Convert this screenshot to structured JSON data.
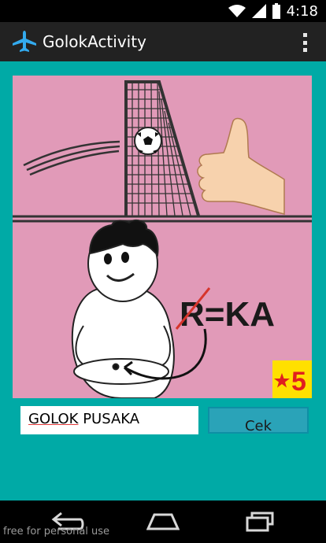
{
  "status_bar": {
    "time": "4:18",
    "icons": [
      "wifi-icon",
      "signal-icon",
      "battery-icon"
    ]
  },
  "action_bar": {
    "title": "GolokActivity",
    "app_icon": "airplane-icon",
    "menu_icon": "overflow-menu-icon"
  },
  "puzzle": {
    "formula_text": "R=KA",
    "struck_letter": "R",
    "level_badge": "5",
    "colors": {
      "background": "#e19ab8",
      "badge": "#ffe000",
      "star": "#e01f1f"
    }
  },
  "answer": {
    "value_underlined": "GOLOK",
    "value_rest": " PUSAKA"
  },
  "check_button": {
    "label": "Cek"
  },
  "nav": {
    "icons": [
      "back-icon",
      "home-icon",
      "recents-icon"
    ]
  },
  "watermark": "free for personal use",
  "colors": {
    "content_bg": "#00aaa6",
    "action_bar": "#222222",
    "button": "#2aa3b8"
  }
}
